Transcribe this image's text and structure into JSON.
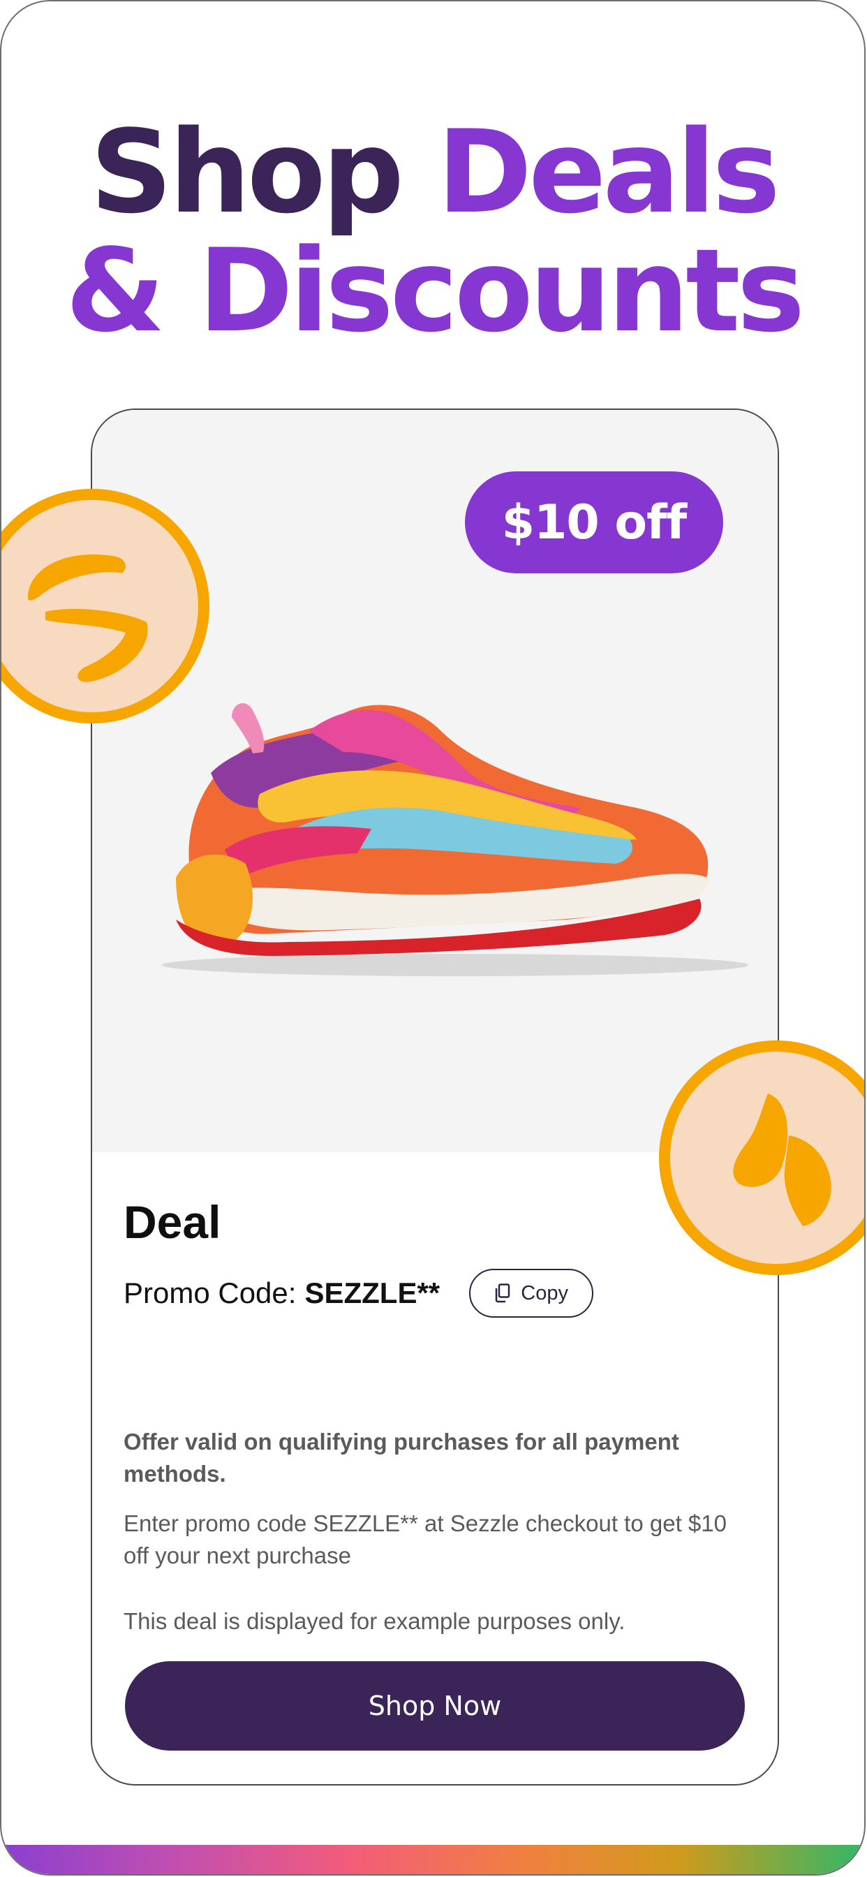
{
  "headline": {
    "part1": "Shop ",
    "part2": "Deals",
    "part3": "& Discounts"
  },
  "card": {
    "badge": "$10 off",
    "title": "Deal",
    "promo_label": "Promo Code:",
    "promo_code": "SEZZLE**",
    "copy_label": "Copy",
    "offer_bold": "Offer valid on qualifying purchases for all payment methods.",
    "offer_line1": "Enter promo code SEZZLE** at Sezzle checkout to get $10 off your next purchase",
    "offer_line2": "This deal is displayed for example purposes only.",
    "cta_label": "Shop Now"
  },
  "colors": {
    "brand_purple": "#8637d2",
    "dark_purple": "#3a2458",
    "coin_orange": "#f7a600",
    "coin_fill": "#f8dac0"
  },
  "icons": [
    "sezzle-logo-icon",
    "copy-icon",
    "shoe-image"
  ]
}
